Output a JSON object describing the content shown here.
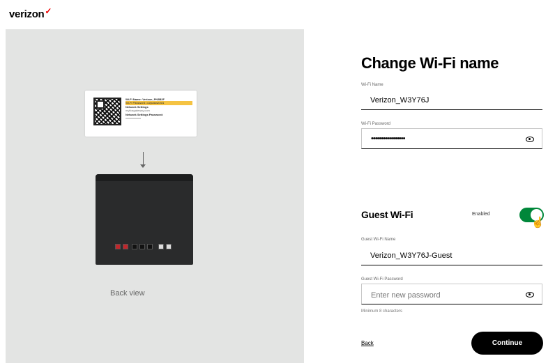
{
  "header": {
    "logo_text": "verizon",
    "logo_mark": "✓"
  },
  "left": {
    "card_lines": [
      {
        "text": "Wi-Fi Name: Verizon_PN3B2F",
        "style": "b"
      },
      {
        "text": "Wi-Fi Password: ourpassword1",
        "style": "hl"
      },
      {
        "text": "Network Settings",
        "style": "b"
      },
      {
        "text": "myfiosgateway.com",
        "style": "g"
      },
      {
        "text": "Network Settings Password:",
        "style": "b"
      },
      {
        "text": "xxxxxxxxxxx",
        "style": "g"
      }
    ],
    "caption": "Back view"
  },
  "form": {
    "title": "Change Wi-Fi name",
    "wifi_name_label": "Wi-Fi Name",
    "wifi_name_value": "Verizon_W3Y76J",
    "wifi_password_label": "Wi-Fi Password",
    "wifi_password_value": "•••••••••••••••••",
    "guest_title": "Guest Wi-Fi",
    "guest_status": "Enabled",
    "guest_enabled": true,
    "guest_name_label": "Guest Wi-Fi Name",
    "guest_name_value": "Verizon_W3Y76J-Guest",
    "guest_password_label": "Guest Wi-Fi Password",
    "guest_password_placeholder": "Enter new password",
    "guest_password_hint": "Minimum 8 characters",
    "back_label": "Back",
    "continue_label": "Continue"
  },
  "colors": {
    "toggle_on": "#00873a",
    "brand_red": "#ee0000",
    "left_bg": "#e3e4e3"
  },
  "icons": {
    "password_toggle": "eye-icon",
    "cursor": "hand-pointer-icon"
  }
}
